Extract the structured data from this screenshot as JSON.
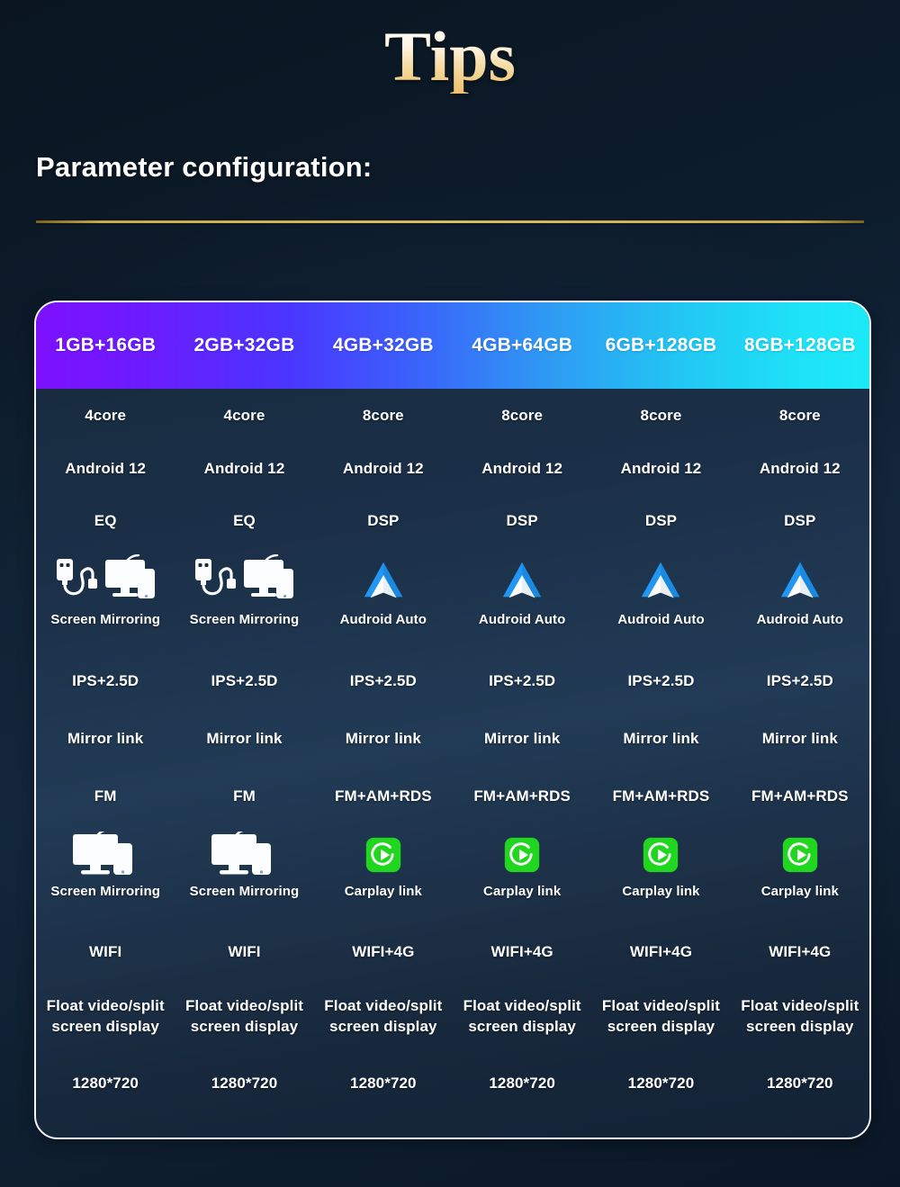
{
  "page": {
    "title": "Tips",
    "section_heading": "Parameter configuration:"
  },
  "table": {
    "columns": [
      "1GB+16GB",
      "2GB+32GB",
      "4GB+32GB",
      "4GB+64GB",
      "6GB+128GB",
      "8GB+128GB"
    ],
    "rows": [
      {
        "key": "cpu_core",
        "values": [
          "4core",
          "4core",
          "8core",
          "8core",
          "8core",
          "8core"
        ]
      },
      {
        "key": "os",
        "values": [
          "Android 12",
          "Android 12",
          "Android 12",
          "Android 12",
          "Android 12",
          "Android 12"
        ]
      },
      {
        "key": "audio",
        "values": [
          "EQ",
          "EQ",
          "DSP",
          "DSP",
          "DSP",
          "DSP"
        ]
      },
      {
        "key": "link_primary",
        "icons": [
          "screen-mirroring-usb-icon",
          "screen-mirroring-usb-icon",
          "android-auto-icon",
          "android-auto-icon",
          "android-auto-icon",
          "android-auto-icon"
        ],
        "values": [
          "Screen Mirroring",
          "Screen Mirroring",
          "Audroid Auto",
          "Audroid Auto",
          "Audroid Auto",
          "Audroid Auto"
        ]
      },
      {
        "key": "display_type",
        "values": [
          "IPS+2.5D",
          "IPS+2.5D",
          "IPS+2.5D",
          "IPS+2.5D",
          "IPS+2.5D",
          "IPS+2.5D"
        ]
      },
      {
        "key": "mirror",
        "values": [
          "Mirror link",
          "Mirror link",
          "Mirror link",
          "Mirror link",
          "Mirror link",
          "Mirror link"
        ]
      },
      {
        "key": "radio",
        "values": [
          "FM",
          "FM",
          "FM+AM+RDS",
          "FM+AM+RDS",
          "FM+AM+RDS",
          "FM+AM+RDS"
        ]
      },
      {
        "key": "link_second",
        "icons": [
          "screen-mirroring-icon",
          "screen-mirroring-icon",
          "carplay-link-icon",
          "carplay-link-icon",
          "carplay-link-icon",
          "carplay-link-icon"
        ],
        "values": [
          "Screen Mirroring",
          "Screen Mirroring",
          "Carplay link",
          "Carplay link",
          "Carplay link",
          "Carplay link"
        ]
      },
      {
        "key": "network",
        "values": [
          "WIFI",
          "WIFI",
          "WIFI+4G",
          "WIFI+4G",
          "WIFI+4G",
          "WIFI+4G"
        ]
      },
      {
        "key": "multiwindow",
        "values": [
          "Float video/split\nscreen display",
          "Float video/split\nscreen display",
          "Float video/split\nscreen display",
          "Float video/split\nscreen display",
          "Float video/split\nscreen display",
          "Float video/split\nscreen display"
        ]
      },
      {
        "key": "resolution",
        "values": [
          "1280*720",
          "1280*720",
          "1280*720",
          "1280*720",
          "1280*720",
          "1280*720"
        ]
      }
    ]
  },
  "colors": {
    "page_background": "#0d1b2a",
    "title_gradient_top": "#ffffff",
    "title_gradient_bottom": "#eec070",
    "gold_rule": "#c9a94b",
    "header_gradient_start": "#7d10ff",
    "header_gradient_end": "#1ce9f8",
    "card_border": "#f2f5f8",
    "text": "#ffffff",
    "carplay_green": "#21d61f",
    "android_auto_blue": "#2196f3",
    "screen_icon_blue": "#2a6ddb"
  }
}
